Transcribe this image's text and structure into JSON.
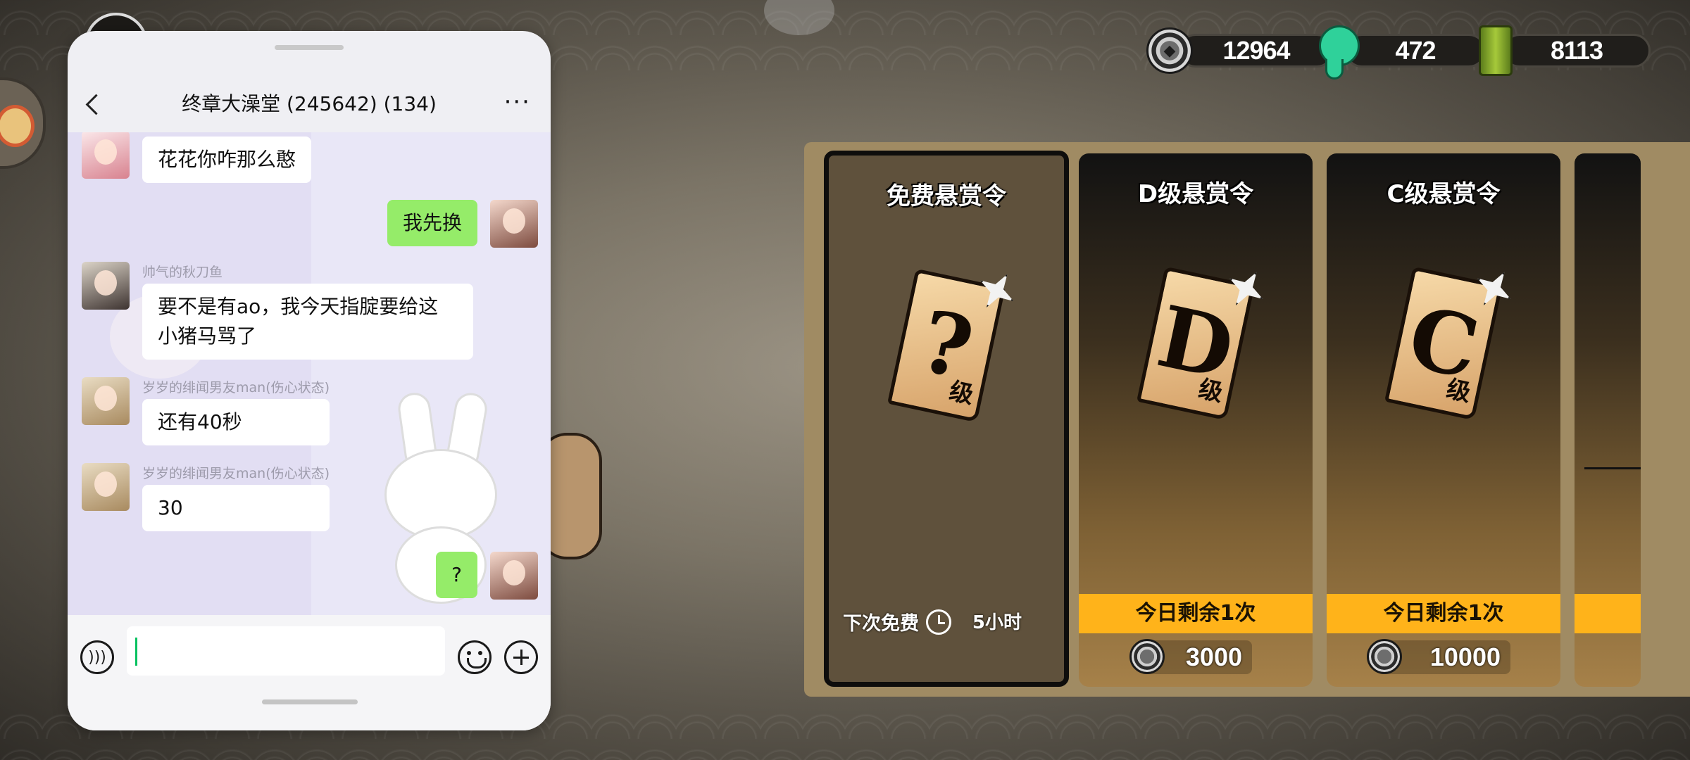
{
  "currencies": [
    {
      "icon": "coin-icon",
      "value": "12964"
    },
    {
      "icon": "jade-icon",
      "value": "472"
    },
    {
      "icon": "scroll-icon",
      "value": "8113"
    }
  ],
  "shop": {
    "cards": [
      {
        "title": "免费悬赏令",
        "ticket_mark": "?",
        "ticket_grade": "级",
        "next_free_label": "下次免费",
        "next_free_time": "5小时"
      },
      {
        "title": "D级悬赏令",
        "ticket_mark": "D",
        "ticket_grade": "级",
        "remaining": "今日剩余1次",
        "price": "3000"
      },
      {
        "title": "C级悬赏令",
        "ticket_mark": "C",
        "ticket_grade": "级",
        "remaining": "今日剩余1次",
        "price": "10000"
      }
    ]
  },
  "chat": {
    "title": "终章大澡堂 (245642) (134)",
    "messages": [
      {
        "sender": "",
        "text": "花花你咋那么憨",
        "from_me": false
      },
      {
        "sender": "",
        "text": "我先换",
        "from_me": true
      },
      {
        "sender": "帅气的秋刀鱼",
        "text": "要不是有ao，我今天指腚要给这小猪马骂了",
        "from_me": false
      },
      {
        "sender": "岁岁的绯闻男友man(伤心状态)",
        "text": "还有40秒",
        "from_me": false
      },
      {
        "sender": "岁岁的绯闻男友man(伤心状态)",
        "text": "30",
        "from_me": false
      },
      {
        "sender": "",
        "text": "?",
        "from_me": true
      }
    ],
    "input": {
      "value": "",
      "placeholder": ""
    }
  },
  "colors": {
    "accent_yellow": "#ffb31a",
    "bubble_me": "#95ec69",
    "chat_bg": "#e9e7f7"
  }
}
